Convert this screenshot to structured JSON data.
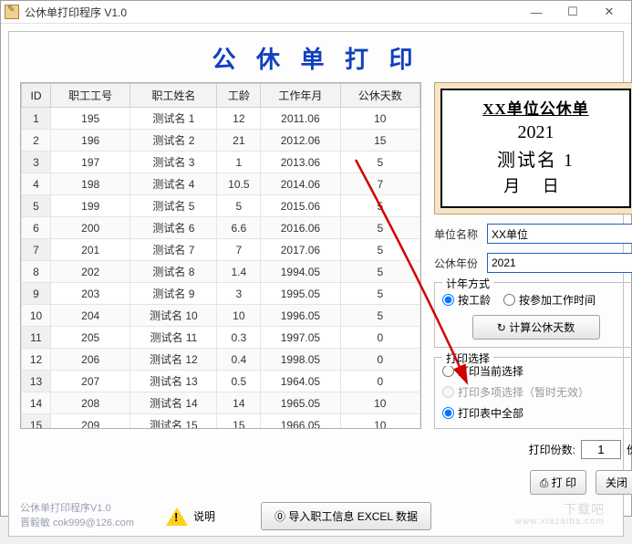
{
  "window": {
    "title": "公休单打印程序 V1.0"
  },
  "heading": "公 休 单 打 印",
  "columns": [
    "ID",
    "职工工号",
    "职工姓名",
    "工龄",
    "工作年月",
    "公休天数"
  ],
  "rows": [
    {
      "id": "1",
      "code": "195",
      "name": "测试名 1",
      "age": "12",
      "ym": "2011.06",
      "days": "10"
    },
    {
      "id": "2",
      "code": "196",
      "name": "测试名 2",
      "age": "21",
      "ym": "2012.06",
      "days": "15"
    },
    {
      "id": "3",
      "code": "197",
      "name": "测试名 3",
      "age": "1",
      "ym": "2013.06",
      "days": "5"
    },
    {
      "id": "4",
      "code": "198",
      "name": "测试名 4",
      "age": "10.5",
      "ym": "2014.06",
      "days": "7"
    },
    {
      "id": "5",
      "code": "199",
      "name": "测试名 5",
      "age": "5",
      "ym": "2015.06",
      "days": "5"
    },
    {
      "id": "6",
      "code": "200",
      "name": "测试名 6",
      "age": "6.6",
      "ym": "2016.06",
      "days": "5"
    },
    {
      "id": "7",
      "code": "201",
      "name": "测试名 7",
      "age": "7",
      "ym": "2017.06",
      "days": "5"
    },
    {
      "id": "8",
      "code": "202",
      "name": "测试名 8",
      "age": "1.4",
      "ym": "1994.05",
      "days": "5"
    },
    {
      "id": "9",
      "code": "203",
      "name": "测试名 9",
      "age": "3",
      "ym": "1995.05",
      "days": "5"
    },
    {
      "id": "10",
      "code": "204",
      "name": "测试名 10",
      "age": "10",
      "ym": "1996.05",
      "days": "5"
    },
    {
      "id": "11",
      "code": "205",
      "name": "测试名 11",
      "age": "0.3",
      "ym": "1997.05",
      "days": "0"
    },
    {
      "id": "12",
      "code": "206",
      "name": "测试名 12",
      "age": "0.4",
      "ym": "1998.05",
      "days": "0"
    },
    {
      "id": "13",
      "code": "207",
      "name": "测试名 13",
      "age": "0.5",
      "ym": "1964.05",
      "days": "0"
    },
    {
      "id": "14",
      "code": "208",
      "name": "测试名 14",
      "age": "14",
      "ym": "1965.05",
      "days": "10"
    },
    {
      "id": "15",
      "code": "209",
      "name": "测试名 15",
      "age": "15",
      "ym": "1966.05",
      "days": "10"
    }
  ],
  "card": {
    "title": "XX单位公休单",
    "year": "2021",
    "name": "测试名 1",
    "date": "月  日"
  },
  "form": {
    "unit_label": "单位名称",
    "unit_value": "XX单位",
    "year_label": "公休年份",
    "year_value": "2021"
  },
  "calc": {
    "legend": "计年方式",
    "by_age": "按工龄",
    "by_date": "按参加工作时间",
    "button": "计算公休天数",
    "icon": "↻"
  },
  "printsel": {
    "legend": "打印选择",
    "opt_current": "打印当前选择",
    "opt_multi": "打印多项选择（暂时无效）",
    "opt_all": "打印表中全部"
  },
  "copies": {
    "label": "打印份数:",
    "value": "1",
    "unit": "份"
  },
  "buttons": {
    "print": "打 印",
    "print_icon": "⎙",
    "close": "关闭",
    "help": "说明",
    "import": "导入职工信息 EXCEL 数据",
    "import_icon": "⓪"
  },
  "footer": {
    "line1": "公休单打印程序V1.0",
    "line2": "晋毅敏 cok999@126.com"
  },
  "watermark": {
    "line1": "下载吧",
    "line2": "www.xiazaiba.com"
  }
}
